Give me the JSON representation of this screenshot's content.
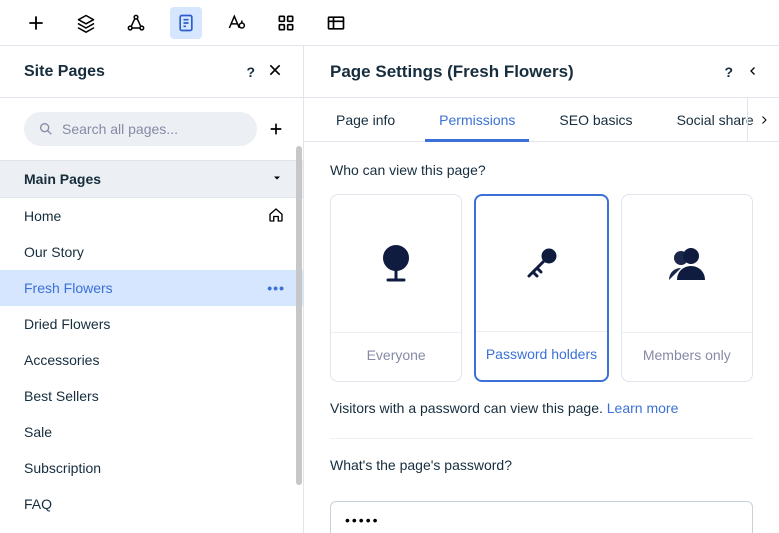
{
  "toolbar": {
    "items": [
      "plus",
      "layers",
      "share-nodes",
      "page",
      "text-style",
      "apps",
      "table"
    ],
    "active_index": 3
  },
  "sidebar": {
    "title": "Site Pages",
    "search_placeholder": "Search all pages...",
    "section_label": "Main Pages",
    "pages": [
      {
        "label": "Home",
        "icon": "home"
      },
      {
        "label": "Our Story"
      },
      {
        "label": "Fresh Flowers",
        "selected": true,
        "more": true
      },
      {
        "label": "Dried Flowers"
      },
      {
        "label": "Accessories"
      },
      {
        "label": "Best Sellers"
      },
      {
        "label": "Sale"
      },
      {
        "label": "Subscription"
      },
      {
        "label": "FAQ"
      }
    ]
  },
  "panel": {
    "title": "Page Settings (Fresh Flowers)",
    "tabs": [
      "Page info",
      "Permissions",
      "SEO basics",
      "Social share"
    ],
    "active_tab": 1,
    "who_can_view_question": "Who can view this page?",
    "options": [
      {
        "label": "Everyone",
        "icon": "globe"
      },
      {
        "label": "Password holders",
        "icon": "key",
        "selected": true
      },
      {
        "label": "Members only",
        "icon": "members"
      }
    ],
    "description_text": "Visitors with a password can view this page. ",
    "learn_more": "Learn more",
    "password_question": "What's the page's password?",
    "password_value": "•••••"
  }
}
